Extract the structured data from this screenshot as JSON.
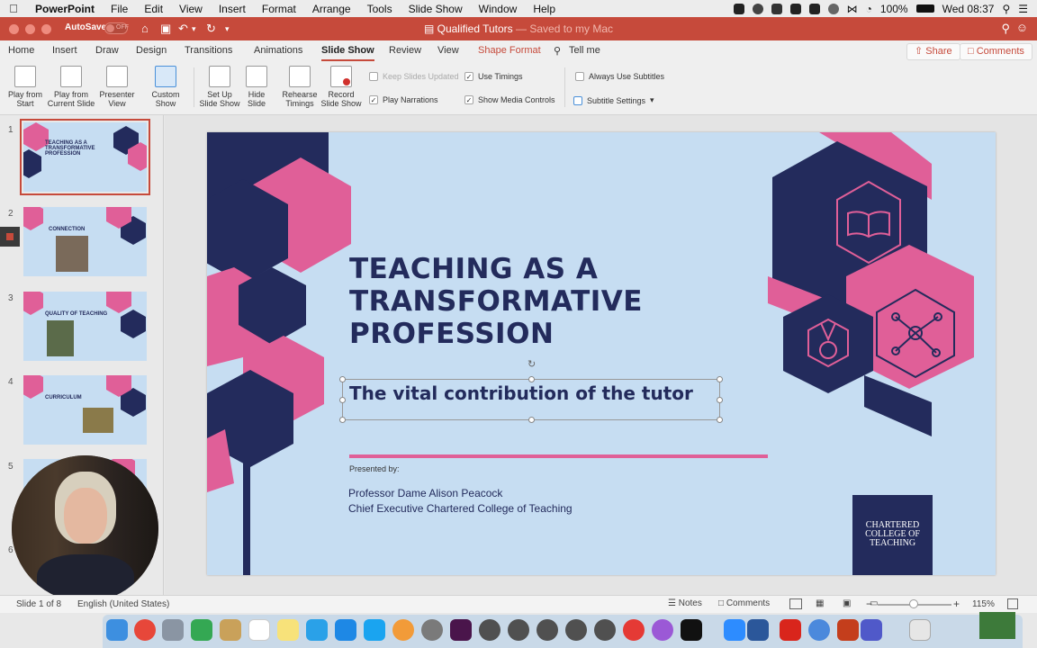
{
  "menubar": {
    "app": "PowerPoint",
    "items": [
      "File",
      "Edit",
      "View",
      "Insert",
      "Format",
      "Arrange",
      "Tools",
      "Slide Show",
      "Window",
      "Help"
    ],
    "battery": "100%",
    "clock": "Wed 08:37"
  },
  "titlebar": {
    "autosave": "AutoSave",
    "autosave_state": "OFF",
    "title": "Qualified Tutors",
    "saved": " — Saved to my Mac"
  },
  "tabs": [
    {
      "label": "Home"
    },
    {
      "label": "Insert"
    },
    {
      "label": "Draw"
    },
    {
      "label": "Design"
    },
    {
      "label": "Transitions"
    },
    {
      "label": "Animations"
    },
    {
      "label": "Slide Show"
    },
    {
      "label": "Review"
    },
    {
      "label": "View"
    },
    {
      "label": "Shape Format"
    },
    {
      "label": "Tell me"
    }
  ],
  "share": "Share",
  "comments": "Comments",
  "ribbon": {
    "play_start": [
      "Play from",
      "Start"
    ],
    "play_current": [
      "Play from",
      "Current Slide"
    ],
    "presenter": [
      "Presenter",
      "View"
    ],
    "custom": [
      "Custom",
      "Show"
    ],
    "setup": [
      "Set Up",
      "Slide Show"
    ],
    "hide": [
      "Hide",
      "Slide"
    ],
    "rehearse": [
      "Rehearse",
      "Timings"
    ],
    "record": [
      "Record",
      "Slide Show"
    ],
    "keep_updated": "Keep Slides Updated",
    "use_timings": "Use Timings",
    "play_narrations": "Play Narrations",
    "show_media": "Show Media Controls",
    "always_subtitles": "Always Use Subtitles",
    "subtitle_settings": "Subtitle Settings"
  },
  "thumbs": [
    {
      "num": "1",
      "title": "TEACHING AS A TRANSFORMATIVE PROFESSION"
    },
    {
      "num": "2",
      "title": "CONNECTION"
    },
    {
      "num": "3",
      "title": "QUALITY OF TEACHING"
    },
    {
      "num": "4",
      "title": "CURRICULUM"
    },
    {
      "num": "5",
      "title": ""
    },
    {
      "num": "6",
      "title": ""
    }
  ],
  "slide": {
    "title": "TEACHING AS A\nTRANSFORMATIVE\nPROFESSION",
    "subtitle": "The vital contribution of the tutor",
    "presented": "Presented by:",
    "presenter1": "Professor Dame Alison Peacock",
    "presenter2": "Chief Executive Chartered College of Teaching",
    "logo": "CHARTERED\nCOLLEGE OF\nTEACHING",
    "colors": {
      "background": "#c6ddf2",
      "navy": "#232b5c",
      "pink": "#e05f98"
    }
  },
  "status": {
    "slide": "Slide 1 of 8",
    "language": "English (United States)",
    "notes": "Notes",
    "comments": "Comments",
    "zoom": "115%"
  }
}
